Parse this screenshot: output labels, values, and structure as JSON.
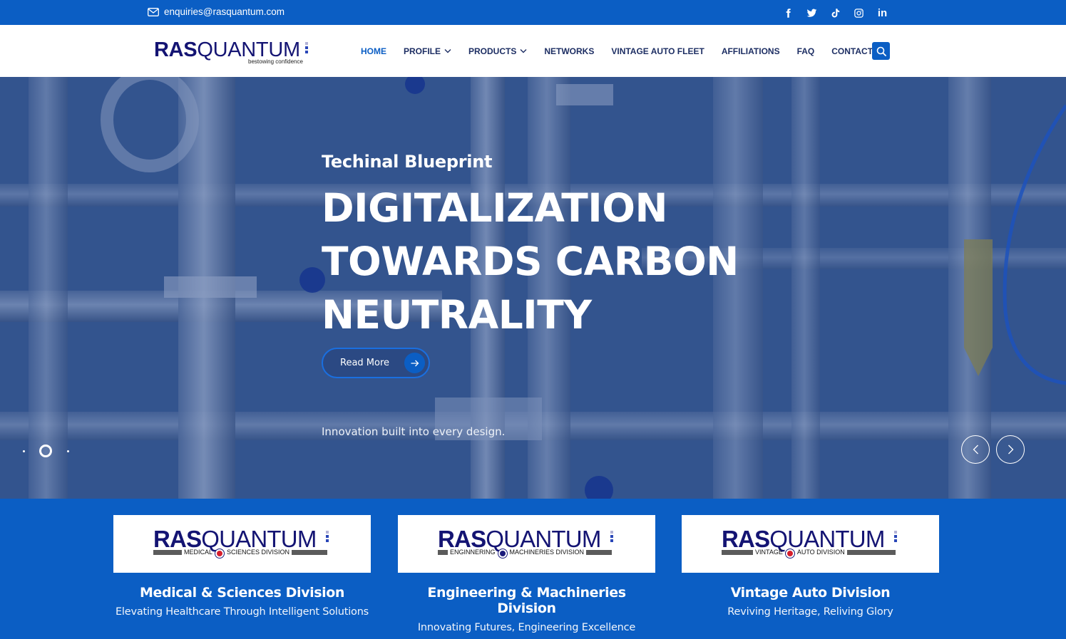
{
  "topbar": {
    "email": "enquiries@rasquantum.com",
    "socials": [
      "facebook-icon",
      "twitter-icon",
      "tiktok-icon",
      "instagram-icon",
      "linkedin-icon"
    ],
    "linkedin_label": "in"
  },
  "logo": {
    "ras": "RAS",
    "quantum": "QUANTUM",
    "tagline": "bestowing confidence"
  },
  "nav": {
    "items": [
      {
        "label": "HOME",
        "active": true
      },
      {
        "label": "PROFILE",
        "dropdown": true
      },
      {
        "label": "PRODUCTS",
        "dropdown": true
      },
      {
        "label": "NETWORKS"
      },
      {
        "label": "VINTAGE AUTO FLEET"
      },
      {
        "label": "AFFILIATIONS"
      },
      {
        "label": "FAQ"
      },
      {
        "label": "CONTACT US"
      }
    ],
    "search_icon": "search-icon"
  },
  "hero": {
    "eyebrow": "Techinal Blueprint",
    "title_lines": [
      "DIGITALIZATION",
      "TOWARDS CARBON",
      "NEUTRALITY"
    ],
    "cta_label": "Read More",
    "subtitle": "Innovation built into every design.",
    "slides_count": 3,
    "active_slide": 2
  },
  "divisions": [
    {
      "logo_ras": "RAS",
      "logo_quantum": "QUANTUM",
      "logo_left": "MEDICAL",
      "logo_right": "SCIENCES  DIVISION",
      "name": "Medical & Sciences Division",
      "desc": "Elevating Healthcare Through Intelligent Solutions"
    },
    {
      "logo_ras": "RAS",
      "logo_quantum": "QUANTUM",
      "logo_left": "ENGINNERING",
      "logo_right": "MACHINERIES  DIVISION",
      "name": "Engineering & Machineries Division",
      "desc": "Innovating Futures, Engineering Excellence"
    },
    {
      "logo_ras": "RAS",
      "logo_quantum": "QUANTUM",
      "logo_left": "VINTAGE",
      "logo_right": "AUTO DIVISION",
      "name": "Vintage Auto Division",
      "desc": "Reviving Heritage, Reliving Glory"
    }
  ],
  "colors": {
    "brand_blue": "#0b5ec4",
    "logo_navy": "#141473",
    "nav_text": "#1d2e63",
    "medical_red": "#d61e2c"
  }
}
